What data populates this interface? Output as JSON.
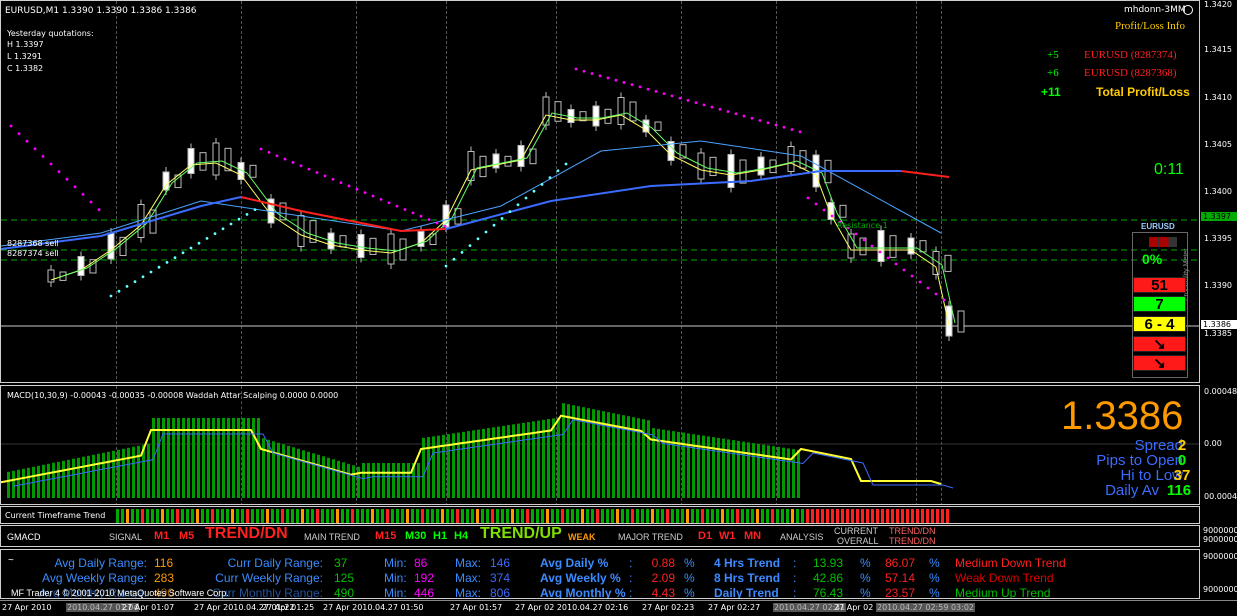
{
  "chart_header": {
    "symbol": "EURUSD,M1  1.3390 1.3390 1.3386 1.3386",
    "account": "mhdonn-3MM",
    "pl_title": "Profit/Loss Info"
  },
  "yesterday": {
    "title": "Yesterday quotations:",
    "h": "H 1.3397",
    "l": "L 1.3291",
    "c": "C 1.3382"
  },
  "pl": {
    "rows": [
      {
        "val": "+5",
        "name": "EURUSD (8287374)"
      },
      {
        "val": "+6",
        "name": "EURUSD (8287368)"
      }
    ],
    "total_val": "+11",
    "total_name": "Total Profit/Loss"
  },
  "timer": "0:11",
  "meter": {
    "symbol": "EURUSD",
    "pct": "0%",
    "b1": "51",
    "b2": "7",
    "b3": "6 - 4",
    "arrow": "↘",
    "vlabel": "Probability Meter"
  },
  "orders": {
    "o1": "8287368 sell",
    "o2": "8287374 sell"
  },
  "resistance_label": "Resistance 1",
  "price_scale": [
    "1.3420",
    "1.3415",
    "1.3410",
    "1.3405",
    "1.3400",
    "1.3395",
    "1.3390",
    "1.3385"
  ],
  "price_box_top": "1.3397",
  "price_box_cur": "1.3386",
  "macd": {
    "title": "MACD(10,30,9) -0.00043 -0.00035 -0.00008   Waddah Attar Scalping 0.0000 0.0000",
    "scale": [
      "0.00048",
      "0.00",
      "00.00048"
    ]
  },
  "info": {
    "price": "1.3386",
    "rows": [
      {
        "label": "Spread",
        "value": "2"
      },
      {
        "label": "Pips to Open",
        "value": "0"
      },
      {
        "label": "Hi to Low",
        "value": "37"
      },
      {
        "label": "Daily Av",
        "value": "116"
      }
    ]
  },
  "trend_title": "Current Timeframe Trend",
  "trend_scale": "9000000",
  "gmacd": {
    "name": "GMACD",
    "signal": "SIGNAL",
    "m1": "M1",
    "m5": "M5",
    "trend_dn": "TREND/DN",
    "main": "MAIN TREND",
    "m15": "M15",
    "m30": "M30",
    "h1": "H1",
    "h4": "H4",
    "trend_up": "TREND/UP",
    "weak": "WEAK",
    "major": "MAJOR TREND",
    "d1": "D1",
    "w1": "W1",
    "mn": "MN",
    "analysis": "ANALYSIS",
    "current": "CURRENT",
    "overall": "OVERALL",
    "tdn1": "TREND/DN",
    "tdn2": "TREND/DN",
    "scale": "9000000"
  },
  "stats": {
    "r1": {
      "a": "Avg Daily Range:",
      "av": "116",
      "b": "Curr Daily Range:",
      "bv": "37",
      "min": "Min:",
      "minv": "86",
      "max": "Max:",
      "maxv": "146",
      "p": "Avg Daily %",
      "pc": ":",
      "pv": "0.88",
      "pp": "%",
      "t": "4 Hrs Trend",
      "tc": ":",
      "t1": "13.93",
      "t1p": "%",
      "t2": "86.07",
      "t2p": "%",
      "tt": "Medium Down Trend"
    },
    "r2": {
      "a": "Avg Weekly Range:",
      "av": "283",
      "b": "Curr Weekly Range:",
      "bv": "125",
      "min": "Min:",
      "minv": "192",
      "max": "Max:",
      "maxv": "374",
      "p": "Avg Weekly %",
      "pc": ":",
      "pv": "2.09",
      "pp": "%",
      "t": "8 Hrs Trend",
      "tc": ":",
      "t1": "42.86",
      "t1p": "%",
      "t2": "57.14",
      "t2p": "%",
      "tt": "Weak Down Trend"
    },
    "r3": {
      "a": "Avg Monthly Range:",
      "av": "490",
      "b": "Curr Monthly Range:",
      "bv": "",
      "min": "Min:",
      "minv": "446",
      "max": "Max:",
      "maxv": "806",
      "p": "Avg Monthly %",
      "pc": ":",
      "pv": "4.43",
      "pp": "%",
      "t": "Daily Trend",
      "tc": ":",
      "t1": "76.43",
      "t1p": "%",
      "t2": "23.57",
      "t2p": "%",
      "tt": "Medium Up Trend"
    },
    "copyright": "MF Trader 4 © 2001-2010 MetaQuotes Software Corp.",
    "tilde": "~"
  },
  "time_axis": [
    "27 Apr 2010",
    "2010.04.27 01:04",
    "27 Apr 01:07",
    "27 Apr 2010.04.27 01:22",
    "27 Apr 01:25",
    "27 Apr 2010.04.27 01:50",
    "27 Apr 01:57",
    "27 Apr 02 2010.04.27 02:16",
    "27 Apr 02:23",
    "27 Apr 02:27",
    "2010.04.27 02:41",
    "27 Apr 02",
    "2010.04.27 02:59 03:02"
  ],
  "colors": {
    "up": "#00ff00",
    "down": "#ff0000",
    "gold": "#ffcc00",
    "blue": "#3b6bff",
    "magenta": "#ff00ff"
  }
}
